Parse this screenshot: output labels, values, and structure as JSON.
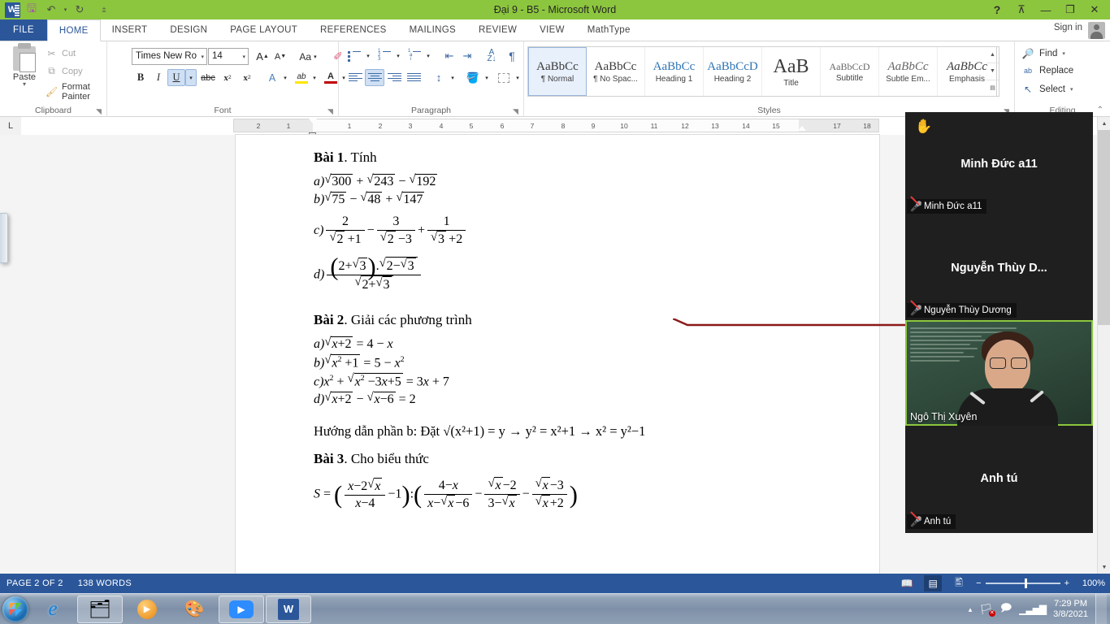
{
  "window": {
    "title": "Đại 9 - B5 - Microsoft Word",
    "sign_in": "Sign in",
    "quick_access": [
      {
        "name": "word-logo",
        "glyph": "W"
      },
      {
        "name": "save-icon",
        "glyph": "🖫"
      },
      {
        "name": "undo-icon",
        "glyph": "↶"
      },
      {
        "name": "undo-dropdown-caret",
        "glyph": "▾"
      },
      {
        "name": "redo-icon",
        "glyph": "↻"
      },
      {
        "name": "customize-qat-caret",
        "glyph": "▾"
      }
    ],
    "controls": [
      {
        "name": "help-button",
        "glyph": "?"
      },
      {
        "name": "ribbon-display-options-button",
        "glyph": "⊼"
      },
      {
        "name": "minimize-button",
        "glyph": "—"
      },
      {
        "name": "restore-button",
        "glyph": "❐"
      },
      {
        "name": "close-button",
        "glyph": "✕"
      }
    ]
  },
  "ribbon": {
    "tabs": [
      {
        "label": "FILE",
        "active": false
      },
      {
        "label": "HOME",
        "active": true
      },
      {
        "label": "INSERT",
        "active": false
      },
      {
        "label": "DESIGN",
        "active": false
      },
      {
        "label": "PAGE LAYOUT",
        "active": false
      },
      {
        "label": "REFERENCES",
        "active": false
      },
      {
        "label": "MAILINGS",
        "active": false
      },
      {
        "label": "REVIEW",
        "active": false
      },
      {
        "label": "VIEW",
        "active": false
      },
      {
        "label": "MathType",
        "active": false
      }
    ],
    "clipboard": {
      "group_label": "Clipboard",
      "paste": "Paste",
      "paste_caret": "▾",
      "cut": "Cut",
      "copy": "Copy",
      "format_painter": "Format Painter",
      "cut_icon": "✂",
      "copy_icon": "⧉",
      "painter_icon": "🖌"
    },
    "font": {
      "group_label": "Font",
      "font_name": "Times New Ro",
      "font_size": "14",
      "grow_font": "A",
      "shrink_font": "A",
      "change_case": "Aa",
      "clear_formatting": "✐",
      "bold": "B",
      "italic": "I",
      "underline": "U",
      "strikethrough": "abc",
      "subscript": "x",
      "superscript": "x",
      "text_effects": "A",
      "highlight": "ab",
      "font_color": "A",
      "caret": "▾"
    },
    "paragraph": {
      "group_label": "Paragraph",
      "bullets": "bullets-list-icon",
      "numbering": "numbered-list-icon",
      "multilevel": "multilevel-list-icon",
      "decrease_indent": "⇤",
      "increase_indent": "⇥",
      "sort": "A\nZ↓",
      "show_marks": "¶",
      "align_left": "align-left-icon",
      "align_center": "align-center-icon",
      "align_right": "align-right-icon",
      "justify": "justify-icon",
      "line_spacing": "↕",
      "shading": "shading-icon",
      "borders": "borders-icon",
      "caret": "▾"
    },
    "styles": {
      "group_label": "Styles",
      "items": [
        {
          "preview": "AaBbCc",
          "name": "¶ Normal",
          "selected": true
        },
        {
          "preview": "AaBbCc",
          "name": "¶ No Spac...",
          "selected": false
        },
        {
          "preview": "AaBbCc",
          "name": "Heading 1",
          "selected": false
        },
        {
          "preview": "AaBbCcD",
          "name": "Heading 2",
          "selected": false
        },
        {
          "preview": "AaB",
          "name": "Title",
          "selected": false
        },
        {
          "preview": "AaBbCcD",
          "name": "Subtitle",
          "selected": false
        },
        {
          "preview": "AaBbCc",
          "name": "Subtle Em...",
          "selected": false
        },
        {
          "preview": "AaBbCc",
          "name": "Emphasis",
          "selected": false
        }
      ],
      "scroll_up": "▲",
      "scroll_down": "▼",
      "more": "▤"
    },
    "editing": {
      "group_label": "Editing",
      "find": "Find",
      "replace": "Replace",
      "select": "Select",
      "find_icon": "🔎",
      "replace_icon": "ab",
      "select_icon": "↖",
      "caret": "▾"
    },
    "collapse_icon": "⌃"
  },
  "ruler": {
    "corner_icon": "L",
    "ticks": [
      "2",
      "1",
      "1",
      "2",
      "3",
      "4",
      "5",
      "6",
      "7",
      "8",
      "9",
      "10",
      "11",
      "12",
      "13",
      "14",
      "15",
      "17",
      "18"
    ]
  },
  "document": {
    "sections": [
      {
        "heading_bold": "Bài 1",
        "heading_rest": ". Tính",
        "lines": [
          "a)√300 + √243 − √192",
          "b)√75 − √48 + √147",
          "c) 2/(√2+1) − 3/(√2−3) + 1/(√3+2)",
          "d) ((2+√3)·√(2−√3)) / √(2+√3)"
        ]
      },
      {
        "heading_bold": "Bài 2",
        "heading_rest": ". Giải các phương trình",
        "lines": [
          "a)√(x+2) = 4 − x",
          "b)√(x²+1) = 5 − x²",
          "c)x² + √(x²−3x+5) = 3x + 7",
          "d)√(x+2) − √(x−6) = 2"
        ]
      },
      {
        "heading_bold": "",
        "heading_rest": "Hướng dẫn phần b: Đặt √(x²+1) = y → y² = x²+1 → x² = y²−1",
        "lines": []
      },
      {
        "heading_bold": "Bài 3",
        "heading_rest": ". Cho biểu thức",
        "lines": [
          "S = ((x−2√x)/(x−4) − 1) : ((4−x)/(x−√x−6) − (√x−2)/(3−√x) − (√x−3)/(√x+2))"
        ]
      }
    ],
    "annotation_color": "#8b1a1a"
  },
  "status_bar": {
    "page": "PAGE 2 OF 2",
    "words": "138 WORDS",
    "views": [
      {
        "name": "read-mode-view-button",
        "glyph": "📖",
        "active": false
      },
      {
        "name": "print-layout-view-button",
        "glyph": "▤",
        "active": true
      },
      {
        "name": "web-layout-view-button",
        "glyph": "🖺",
        "active": false
      }
    ],
    "zoom_out": "−",
    "zoom_in": "+",
    "zoom_level": "100%"
  },
  "meeting": {
    "tiles": [
      {
        "display_name": "Minh Đức a11",
        "badge_name": "Minh Đức a11",
        "muted": true,
        "has_video": false,
        "raised_hand": true
      },
      {
        "display_name": "Nguyễn Thùy D...",
        "badge_name": "Nguyễn Thùy Dương",
        "muted": true,
        "has_video": false,
        "raised_hand": false
      },
      {
        "display_name": "",
        "badge_name": "Ngô Thị Xuyên",
        "muted": false,
        "has_video": true,
        "raised_hand": false
      },
      {
        "display_name": "Anh tú",
        "badge_name": "Anh tú",
        "muted": true,
        "has_video": false,
        "raised_hand": false
      }
    ],
    "mute_icon": "🎤",
    "hand_icon": "✋",
    "active_border_color": "#8cc63e"
  },
  "taskbar": {
    "start_label": "Start",
    "items": [
      {
        "name": "internet-explorer-icon",
        "glyph": "e",
        "pinned": false
      },
      {
        "name": "file-explorer-icon",
        "glyph": "🗂",
        "pinned": true
      },
      {
        "name": "media-player-icon",
        "glyph": "▶",
        "pinned": false
      },
      {
        "name": "paint-icon",
        "glyph": "🎨",
        "pinned": false
      },
      {
        "name": "zoom-meeting-icon",
        "glyph": "🎥",
        "pinned": true
      },
      {
        "name": "word-taskbar-icon",
        "glyph": "W",
        "pinned": true
      }
    ],
    "tray": {
      "show_hidden": "▴",
      "network_icon": "network-icon",
      "action_icon": "action-center-icon",
      "signal_icon": "signal-bars-icon",
      "time": "7:29 PM",
      "date": "3/8/2021"
    }
  }
}
